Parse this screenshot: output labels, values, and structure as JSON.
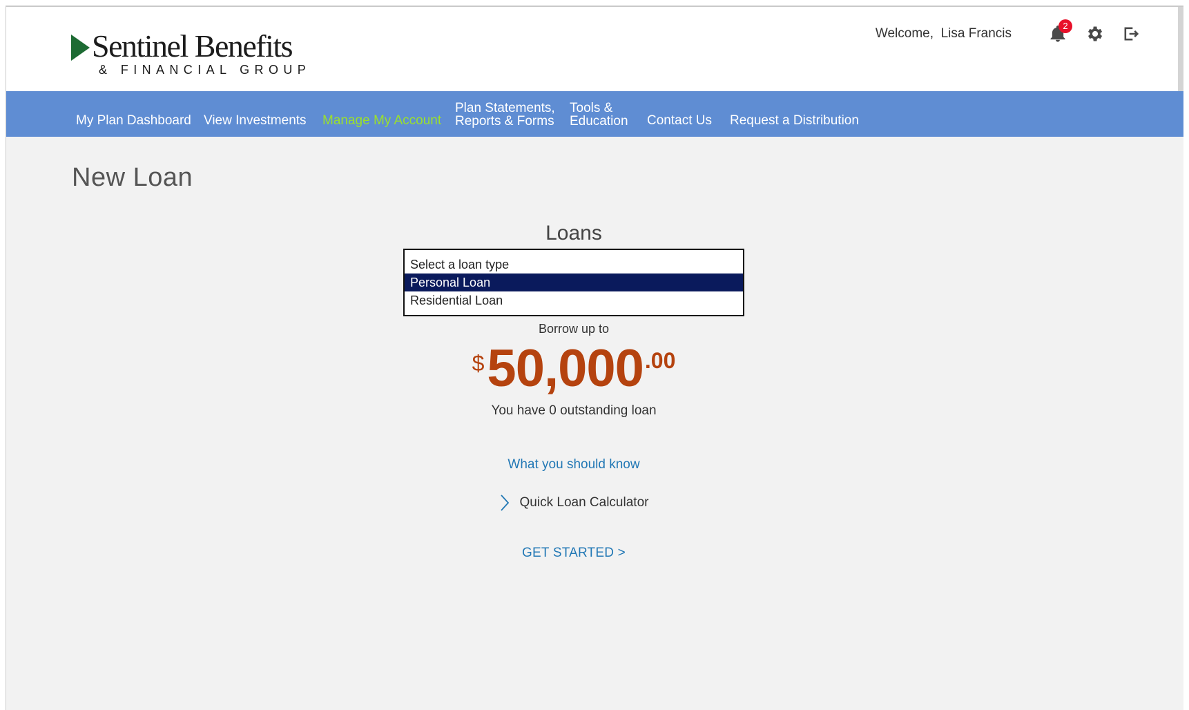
{
  "brand": {
    "name": "Sentinel Benefits",
    "subtitle": "& FINANCIAL GROUP"
  },
  "user": {
    "welcome_label": "Welcome,",
    "name": "Lisa Francis",
    "notification_count": "2"
  },
  "nav": {
    "items": [
      {
        "label": "My Plan Dashboard"
      },
      {
        "label": "View Investments"
      },
      {
        "label": "Manage My Account",
        "active": true
      },
      {
        "line1": "Plan Statements,",
        "line2": "Reports & Forms"
      },
      {
        "line1": "Tools &",
        "line2": "Education"
      },
      {
        "label": "Contact Us"
      },
      {
        "label": "Request a Distribution"
      }
    ]
  },
  "page": {
    "title": "New Loan"
  },
  "loans": {
    "heading": "Loans",
    "options": [
      {
        "label": "Select a loan type"
      },
      {
        "label": "Personal Loan",
        "selected": true
      },
      {
        "label": "Residential Loan"
      }
    ],
    "borrow_label": "Borrow up to",
    "amount": {
      "currency": "$",
      "whole": "50,000",
      "cents": ".00"
    },
    "outstanding_text": "You have 0 outstanding loan",
    "know_link": "What you should know",
    "calculator_label": "Quick Loan Calculator",
    "get_started": "GET STARTED >"
  },
  "colors": {
    "nav_background": "#5f8dd3",
    "nav_active": "#9be02c",
    "amount": "#b5430f",
    "link": "#2278b5",
    "selected_option": "#0a1a5c",
    "badge": "#e8102a",
    "logo_mark": "#1d6b33"
  }
}
